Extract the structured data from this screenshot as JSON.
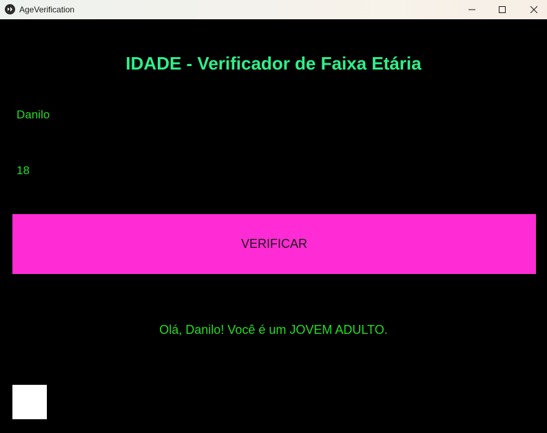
{
  "window": {
    "title": "AgeVerification",
    "icon": "kivy-app-icon",
    "controls": [
      "minimize-icon",
      "maximize-icon",
      "close-icon"
    ]
  },
  "main": {
    "heading": "IDADE - Verificador de Faixa Etária",
    "name_input": {
      "value": "Danilo"
    },
    "age_input": {
      "value": "18"
    },
    "verify_button": {
      "label": "VERIFICAR"
    },
    "result_text": "Olá, Danilo! Você é um JOVEM ADULTO."
  },
  "colors": {
    "background": "#000000",
    "heading": "#2ff08a",
    "text": "#22dd22",
    "button": "#ff2bd4",
    "button_text": "#1a1a1a"
  }
}
